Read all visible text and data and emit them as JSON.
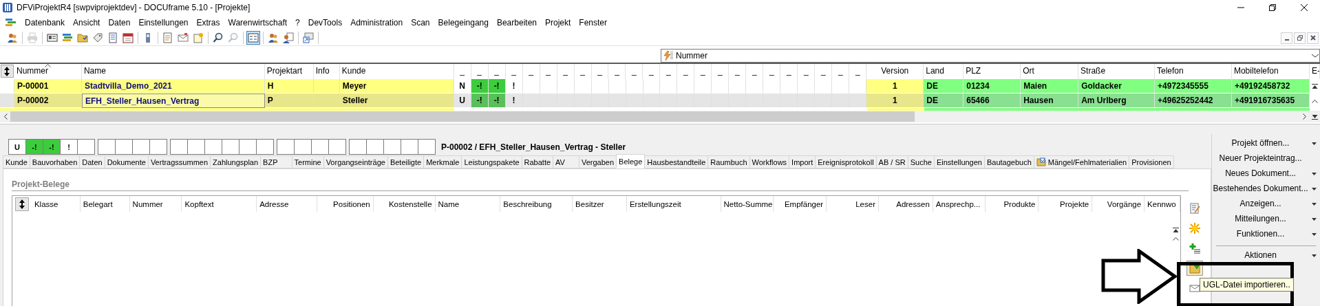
{
  "window": {
    "title": "DFViProjektR4 [swpviprojektdev] - DOCUframe 5.10 - [Projekte]"
  },
  "menu": [
    "Datenbank",
    "Ansicht",
    "Daten",
    "Einstellungen",
    "Extras",
    "Warenwirtschaft",
    "?",
    "DevTools",
    "Administration",
    "Scan",
    "Belegeingang",
    "Bearbeiten",
    "Projekt",
    "Fenster"
  ],
  "toolbar": [
    [
      {
        "kind": "people",
        "disabled": false,
        "pressed": false
      }
    ],
    [
      {
        "kind": "printer",
        "disabled": true,
        "pressed": false
      }
    ],
    [
      {
        "kind": "card",
        "disabled": false,
        "pressed": false
      },
      {
        "kind": "list",
        "disabled": false,
        "pressed": false
      },
      {
        "kind": "folder",
        "disabled": false,
        "pressed": false
      },
      {
        "kind": "tag",
        "disabled": false,
        "pressed": false
      },
      {
        "kind": "document",
        "disabled": false,
        "pressed": false
      },
      {
        "kind": "calendar",
        "disabled": false,
        "pressed": false
      }
    ],
    [
      {
        "kind": "phone",
        "disabled": false,
        "pressed": false
      }
    ],
    [
      {
        "kind": "note",
        "disabled": false,
        "pressed": false
      },
      {
        "kind": "mail",
        "disabled": false,
        "pressed": false
      },
      {
        "kind": "newdoc",
        "disabled": false,
        "pressed": false
      }
    ],
    [
      {
        "kind": "search",
        "disabled": false,
        "pressed": false
      },
      {
        "kind": "search",
        "disabled": true,
        "pressed": false
      }
    ],
    [
      {
        "kind": "window",
        "disabled": false,
        "pressed": true
      }
    ],
    [
      {
        "kind": "people",
        "disabled": false,
        "pressed": false
      },
      {
        "kind": "docpeople",
        "disabled": false,
        "pressed": false
      }
    ],
    [
      {
        "kind": "shortcut",
        "disabled": false,
        "pressed": false
      }
    ]
  ],
  "filter_field": {
    "value": "Nummer"
  },
  "projects": {
    "columns": [
      {
        "label": "Nummer",
        "kind": "id",
        "sorted": true
      },
      {
        "label": "Name",
        "kind": "name",
        "sorted": false
      },
      {
        "label": "Projektart",
        "kind": "text",
        "sorted": false
      },
      {
        "label": "Info",
        "kind": "info",
        "sorted": false
      },
      {
        "label": "Kunde",
        "kind": "text",
        "sorted": false
      },
      {
        "label": "_",
        "kind": "flag",
        "sorted": false
      },
      {
        "label": "_",
        "kind": "flag",
        "sorted": false
      },
      {
        "label": "_",
        "kind": "flag",
        "sorted": false
      },
      {
        "label": "_",
        "kind": "flag",
        "sorted": false
      },
      {
        "label": "_",
        "kind": "flag",
        "sorted": false
      },
      {
        "label": "_",
        "kind": "flag",
        "sorted": false
      },
      {
        "label": "_",
        "kind": "flag",
        "sorted": false
      },
      {
        "label": "_",
        "kind": "flag",
        "sorted": false
      },
      {
        "label": "_",
        "kind": "flag",
        "sorted": false
      },
      {
        "label": "_",
        "kind": "flag",
        "sorted": false
      },
      {
        "label": "_",
        "kind": "flag",
        "sorted": false
      },
      {
        "label": "_",
        "kind": "flag",
        "sorted": false
      },
      {
        "label": "_",
        "kind": "flag",
        "sorted": false
      },
      {
        "label": "_",
        "kind": "flag",
        "sorted": false
      },
      {
        "label": "_",
        "kind": "flag",
        "sorted": false
      },
      {
        "label": "_",
        "kind": "flag",
        "sorted": false
      },
      {
        "label": "_",
        "kind": "flag",
        "sorted": false
      },
      {
        "label": "_",
        "kind": "flag",
        "sorted": false
      },
      {
        "label": "_",
        "kind": "flag",
        "sorted": false
      },
      {
        "label": "_",
        "kind": "flag",
        "sorted": false
      },
      {
        "label": "_",
        "kind": "flag",
        "sorted": false
      },
      {
        "label": "_",
        "kind": "flag",
        "sorted": false
      },
      {
        "label": "_",
        "kind": "flag",
        "sorted": false
      },
      {
        "label": "_",
        "kind": "flag",
        "sorted": false
      },
      {
        "label": "Version",
        "kind": "version",
        "sorted": false
      },
      {
        "label": "Land",
        "kind": "contact",
        "sorted": false
      },
      {
        "label": "PLZ",
        "kind": "contact",
        "sorted": false
      },
      {
        "label": "Ort",
        "kind": "contact",
        "sorted": false
      },
      {
        "label": "Straße",
        "kind": "contact",
        "sorted": false
      },
      {
        "label": "Telefon",
        "kind": "contact",
        "sorted": false
      },
      {
        "label": "Mobiltelefon",
        "kind": "contact",
        "sorted": false
      },
      {
        "label": "E-",
        "kind": "edge",
        "sorted": false
      }
    ],
    "rows": [
      {
        "selected": false,
        "focused": false,
        "cells": [
          "P-00001",
          "Stadtvilla_Demo_2021",
          "H",
          "Meyer"
        ],
        "flags": [
          {
            "text": "N",
            "kind": "plain"
          },
          {
            "text": "-!",
            "kind": "alert"
          },
          {
            "text": "-!",
            "kind": "alert"
          },
          {
            "text": "!",
            "kind": "plain"
          }
        ],
        "version": "1",
        "contact": [
          "DE",
          "01234",
          "Maien",
          "Goldacker",
          "+4972345555",
          "+49192458732"
        ]
      },
      {
        "selected": true,
        "focused": true,
        "cells": [
          "P-00002",
          "EFH_Steller_Hausen_Vertrag",
          "P",
          "Steller"
        ],
        "flags": [
          {
            "text": "U",
            "kind": "plain"
          },
          {
            "text": "-!",
            "kind": "alert"
          },
          {
            "text": "-!",
            "kind": "alert"
          },
          {
            "text": "!",
            "kind": "plain"
          }
        ],
        "version": "1",
        "contact": [
          "DE",
          "65466",
          "Hausen",
          "Am Urlberg",
          "+49625252442",
          "+491916735635"
        ]
      }
    ]
  },
  "status_strip": {
    "groups": [
      [
        {
          "text": "U",
          "kind": "plain"
        },
        {
          "text": "-!",
          "kind": "alert"
        },
        {
          "text": "-!",
          "kind": "alert"
        },
        {
          "text": "!",
          "kind": "plain"
        },
        {
          "kind": "plain"
        }
      ],
      [
        {
          "kind": "plain"
        },
        {
          "kind": "plain"
        },
        {
          "kind": "plain"
        },
        {
          "kind": "plain"
        }
      ],
      [
        {
          "kind": "plain"
        },
        {
          "kind": "plain"
        },
        {
          "kind": "plain"
        },
        {
          "kind": "plain"
        },
        {
          "kind": "plain"
        },
        {
          "kind": "plain"
        }
      ],
      [
        {
          "kind": "plain"
        },
        {
          "kind": "plain"
        },
        {
          "kind": "plain"
        },
        {
          "kind": "plain"
        }
      ],
      [
        {
          "kind": "plain"
        },
        {
          "kind": "plain"
        },
        {
          "kind": "plain"
        },
        {
          "kind": "plain"
        },
        {
          "kind": "plain"
        }
      ]
    ],
    "caption": "P-00002 / EFH_Steller_Hausen_Vertrag - Steller"
  },
  "tabs": [
    {
      "label": "Kunde",
      "selected": false,
      "kind": "plain"
    },
    {
      "label": "Bauvorhaben",
      "selected": false,
      "kind": "plain"
    },
    {
      "label": "Daten",
      "selected": false,
      "kind": "plain"
    },
    {
      "label": "Dokumente",
      "selected": false,
      "kind": "plain"
    },
    {
      "label": "Vertragssummen",
      "selected": false,
      "kind": "plain"
    },
    {
      "label": "Zahlungsplan",
      "selected": false,
      "kind": "plain"
    },
    {
      "label": "BZP",
      "selected": false,
      "kind": "plain"
    },
    {
      "label": "Termine",
      "selected": false,
      "kind": "plain"
    },
    {
      "label": "Vorgangseinträge",
      "selected": false,
      "kind": "plain"
    },
    {
      "label": "Beteiligte",
      "selected": false,
      "kind": "plain"
    },
    {
      "label": "Merkmale",
      "selected": false,
      "kind": "plain"
    },
    {
      "label": "Leistungspakete",
      "selected": false,
      "kind": "plain"
    },
    {
      "label": "Rabatte",
      "selected": false,
      "kind": "plain"
    },
    {
      "label": "AV",
      "selected": false,
      "kind": "plain"
    },
    {
      "label": "Vergaben",
      "selected": false,
      "kind": "plain"
    },
    {
      "label": "Belege",
      "selected": true,
      "kind": "plain"
    },
    {
      "label": "Hausbestandteile",
      "selected": false,
      "kind": "plain"
    },
    {
      "label": "Raumbuch",
      "selected": false,
      "kind": "plain"
    },
    {
      "label": "Workflows",
      "selected": false,
      "kind": "plain"
    },
    {
      "label": "Import",
      "selected": false,
      "kind": "plain"
    },
    {
      "label": "Ereignisprotokoll",
      "selected": false,
      "kind": "plain"
    },
    {
      "label": "AB / SR",
      "selected": false,
      "kind": "plain"
    },
    {
      "label": "Suche",
      "selected": false,
      "kind": "plain"
    },
    {
      "label": "Einstellungen",
      "selected": false,
      "kind": "plain"
    },
    {
      "label": "Bautagebuch",
      "selected": false,
      "kind": "plain"
    },
    {
      "label": "Mängel/Fehlmaterialien",
      "selected": false,
      "kind": "icon"
    },
    {
      "label": "Provisionen",
      "selected": false,
      "kind": "plain"
    }
  ],
  "documents": {
    "title": "Projekt-Belege",
    "columns": [
      {
        "label": "Klasse",
        "kind": "text"
      },
      {
        "label": "Belegart",
        "kind": "text"
      },
      {
        "label": "Nummer",
        "kind": "text"
      },
      {
        "label": "Kopftext",
        "kind": "text"
      },
      {
        "label": "Adresse",
        "kind": "text"
      },
      {
        "label": "Positionen",
        "kind": "numeric"
      },
      {
        "label": "Kostenstelle",
        "kind": "numeric"
      },
      {
        "label": "Name",
        "kind": "text"
      },
      {
        "label": "Beschreibung",
        "kind": "text"
      },
      {
        "label": "Besitzer",
        "kind": "text"
      },
      {
        "label": "Erstellungszeit",
        "kind": "text"
      },
      {
        "label": "Netto-Summe",
        "kind": "numeric"
      },
      {
        "label": "Empfänger",
        "kind": "numeric"
      },
      {
        "label": "Leser",
        "kind": "numeric"
      },
      {
        "label": "Adressen",
        "kind": "numeric"
      },
      {
        "label": "Ansprechp...",
        "kind": "text"
      },
      {
        "label": "Produkte",
        "kind": "numeric"
      },
      {
        "label": "Projekte",
        "kind": "numeric"
      },
      {
        "label": "Vorgänge",
        "kind": "numeric"
      },
      {
        "label": "Kennwo",
        "kind": "text"
      }
    ]
  },
  "side_tools": [
    {
      "kind": "edit",
      "hovered": false
    },
    {
      "kind": "star",
      "hovered": false
    },
    {
      "kind": "add",
      "hovered": false
    },
    {
      "kind": "import",
      "hovered": true
    },
    {
      "kind": "mail",
      "hovered": false
    }
  ],
  "tooltip": {
    "text": "UGL-Datei importieren.."
  },
  "actions_panel": {
    "items": [
      {
        "label": "Projekt öffnen...",
        "dropdown": true
      },
      {
        "label": "Neuer Projekteintrag...",
        "dropdown": false
      },
      {
        "label": "Neues Dokument...",
        "dropdown": true
      },
      {
        "label": "Bestehendes Dokument...",
        "dropdown": true
      },
      {
        "label": "Anzeigen...",
        "dropdown": true
      },
      {
        "label": "Mitteilungen...",
        "dropdown": true
      },
      {
        "label": "Funktionen...",
        "dropdown": true
      }
    ],
    "footer": {
      "label": "Aktionen",
      "dropdown": true
    }
  }
}
